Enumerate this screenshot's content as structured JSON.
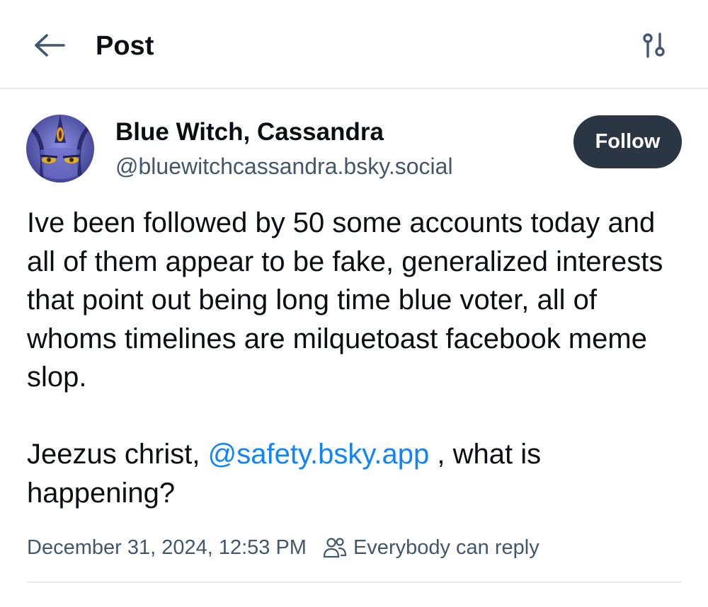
{
  "header": {
    "back_icon": "arrow-left-icon",
    "title": "Post",
    "settings_icon": "sliders-icon"
  },
  "author": {
    "display_name": "Blue Witch, Cassandra",
    "handle": "@bluewitchcassandra.bsky.social",
    "avatar_icon": "user-avatar"
  },
  "follow_button": {
    "label": "Follow"
  },
  "post": {
    "paragraph1": "Ive been followed by 50 some accounts today and all of them appear to be fake, generalized interests that point out being long time blue voter, all of whoms timelines are milquetoast facebook meme slop.",
    "paragraph2_prefix": "Jeezus christ, ",
    "mention": "@safety.bsky.app",
    "paragraph2_suffix": " , what is happening?"
  },
  "meta": {
    "timestamp": "December 31, 2024, 12:53 PM",
    "reply_icon": "people-icon",
    "reply_setting": "Everybody can reply"
  },
  "colors": {
    "text": "#0b0f14",
    "muted": "#42576c",
    "link": "#1083fe",
    "follow_bg": "#2a3644",
    "border": "#e7ebef",
    "icon_header": "#3f5773"
  }
}
